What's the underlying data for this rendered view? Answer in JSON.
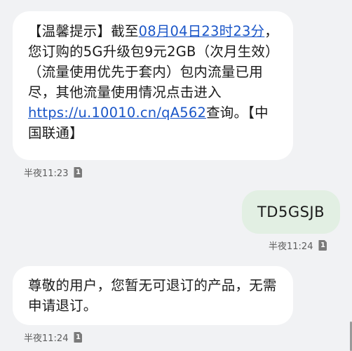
{
  "messages": [
    {
      "direction": "incoming",
      "parts": {
        "prefix": "【温馨提示】截至",
        "date_link": "08月04日23时23分",
        "body": "，您订购的5G升级包9元2GB（次月生效）（流量使用优先于套内）包内流量已用尽，其他流量使用情况点击进入 ",
        "url": "https://u.10010.cn/qA562",
        "suffix": "查询。【中国联通】"
      },
      "time": "半夜11:23",
      "sim": "1"
    },
    {
      "direction": "outgoing",
      "text": "TD5GSJB",
      "time": "半夜11:24",
      "sim": "1"
    },
    {
      "direction": "incoming",
      "text": "尊敬的用户，您暂无可退订的产品，无需申请退订。",
      "time": "半夜11:24",
      "sim": "1"
    }
  ],
  "colors": {
    "background": "#f1f2f4",
    "incoming_bubble": "#ffffff",
    "outgoing_bubble": "#e2efe3",
    "link": "#1a56c8"
  }
}
